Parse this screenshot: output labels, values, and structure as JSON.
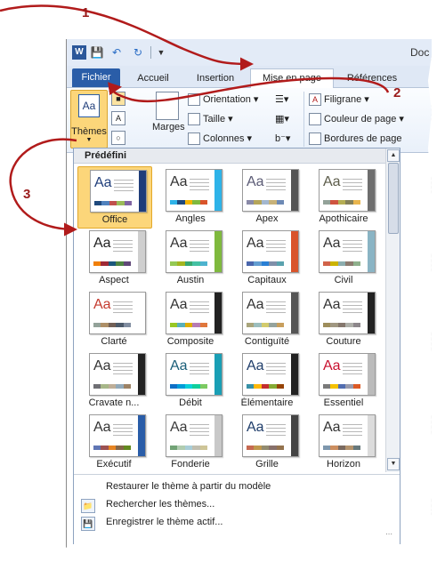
{
  "quick_access": {
    "app_icon": "W",
    "undo_icon": "undo-icon",
    "redo_icon": "redo-icon"
  },
  "window_title": "Doc",
  "tabs": [
    {
      "label": "Fichier"
    },
    {
      "label": "Accueil"
    },
    {
      "label": "Insertion"
    },
    {
      "label": "Mise en page"
    },
    {
      "label": "Références"
    }
  ],
  "ribbon": {
    "themes_label": "Thèmes",
    "themes_icon_text": "Aa",
    "marges_label": "Marges",
    "orientation_label": "Orientation",
    "taille_label": "Taille",
    "colonnes_label": "Colonnes",
    "filigrane_label": "Filigrane",
    "couleur_label": "Couleur de page",
    "bordures_label": "Bordures de page"
  },
  "gallery": {
    "section_title": "Prédéfini",
    "themes": [
      {
        "label": "Office",
        "aa": "Aa",
        "accent": "#1f3d7a",
        "aa_color": "#1f3d7a",
        "swatches": [
          "#1f497d",
          "#4f81bd",
          "#c0504d",
          "#9bbb59",
          "#8064a2"
        ]
      },
      {
        "label": "Angles",
        "aa": "Aa",
        "accent": "#2eb3e8",
        "aa_color": "#333333",
        "swatches": [
          "#2eb3e8",
          "#1f497d",
          "#f4b400",
          "#7fb93e",
          "#d9542b"
        ]
      },
      {
        "label": "Apex",
        "aa": "Aa",
        "accent": "#555555",
        "aa_color": "#5b5b75",
        "swatches": [
          "#8a8aa8",
          "#b5a55a",
          "#a3b7cf",
          "#c7b279",
          "#6d8ab5"
        ]
      },
      {
        "label": "Apothicaire",
        "aa": "Aa",
        "accent": "#6e6e6e",
        "aa_color": "#5c5c4a",
        "swatches": [
          "#93a299",
          "#cf543f",
          "#b5ae53",
          "#848058",
          "#e8b54d"
        ]
      },
      {
        "label": "Aspect",
        "aa": "Aa",
        "accent": "#cfcfcf",
        "aa_color": "#222222",
        "swatches": [
          "#f07f09",
          "#9f2936",
          "#1b587c",
          "#4e8542",
          "#604878"
        ]
      },
      {
        "label": "Austin",
        "aa": "Aa",
        "accent": "#7fb93e",
        "aa_color": "#333333",
        "swatches": [
          "#94c954",
          "#a3b61f",
          "#37a76f",
          "#44c1a3",
          "#4eb3cf"
        ]
      },
      {
        "label": "Capitaux",
        "aa": "Aa",
        "accent": "#d9542b",
        "aa_color": "#333333",
        "swatches": [
          "#4a66ac",
          "#629dd1",
          "#297fd5",
          "#7f8fa9",
          "#5aa2ae"
        ]
      },
      {
        "label": "Civil",
        "aa": "Aa",
        "accent": "#8ab4c4",
        "aa_color": "#333333",
        "swatches": [
          "#d16349",
          "#ccb400",
          "#8cadae",
          "#8c7b70",
          "#8fb08c"
        ]
      },
      {
        "label": "Clarté",
        "aa": "Aa",
        "accent": "#ffffff",
        "aa_color": "#c43a2e",
        "swatches": [
          "#93a299",
          "#ad8f67",
          "#726056",
          "#4c5a6a",
          "#808da0"
        ]
      },
      {
        "label": "Composite",
        "aa": "Aa",
        "accent": "#222222",
        "aa_color": "#333333",
        "swatches": [
          "#98c723",
          "#59b0b9",
          "#deae00",
          "#b77bb4",
          "#e0773c"
        ]
      },
      {
        "label": "Contiguïté",
        "aa": "Aa",
        "accent": "#555555",
        "aa_color": "#333333",
        "swatches": [
          "#a9a57c",
          "#9cbebd",
          "#d2cb6c",
          "#95a39d",
          "#c89f5d"
        ]
      },
      {
        "label": "Couture",
        "aa": "Aa",
        "accent": "#222222",
        "aa_color": "#333333",
        "swatches": [
          "#9e8e5c",
          "#a09781",
          "#85776d",
          "#aeafa9",
          "#8d878b"
        ]
      },
      {
        "label": "Cravate n...",
        "aa": "Aa",
        "accent": "#222222",
        "aa_color": "#333333",
        "swatches": [
          "#6f6f74",
          "#a7b789",
          "#beae98",
          "#92a9b9",
          "#9c8265"
        ]
      },
      {
        "label": "Débit",
        "aa": "Aa",
        "accent": "#1a9fb5",
        "aa_color": "#1a5e78",
        "swatches": [
          "#0f6fc6",
          "#009dd9",
          "#0bd0d9",
          "#10cf9b",
          "#7cca62"
        ]
      },
      {
        "label": "Élémentaire",
        "aa": "Aa",
        "accent": "#222222",
        "aa_color": "#1f3d6a",
        "swatches": [
          "#3891a7",
          "#feb80a",
          "#c32d2e",
          "#84aa33",
          "#964305"
        ]
      },
      {
        "label": "Essentiel",
        "aa": "Aa",
        "accent": "#bbbbbb",
        "aa_color": "#c8102e",
        "swatches": [
          "#7a7a7a",
          "#f5c201",
          "#526db0",
          "#989aac",
          "#dc5924"
        ]
      },
      {
        "label": "Exécutif",
        "aa": "Aa",
        "accent": "#2a5da8",
        "aa_color": "#333333",
        "swatches": [
          "#6076b4",
          "#9c5252",
          "#e68422",
          "#846648",
          "#63891f"
        ]
      },
      {
        "label": "Fonderie",
        "aa": "Aa",
        "accent": "#c8c8c8",
        "aa_color": "#3a3a3a",
        "swatches": [
          "#72a376",
          "#b0ccb0",
          "#a8cdd7",
          "#c0beaf",
          "#cec597"
        ]
      },
      {
        "label": "Grille",
        "aa": "Aa",
        "accent": "#444444",
        "aa_color": "#1f3d6a",
        "swatches": [
          "#c66951",
          "#bf974d",
          "#928b70",
          "#87706b",
          "#94734e"
        ]
      },
      {
        "label": "Horizon",
        "aa": "Aa",
        "accent": "#dcdcdc",
        "aa_color": "#333333",
        "swatches": [
          "#7e97ad",
          "#cc8e60",
          "#7a6a60",
          "#b4936d",
          "#67787b"
        ]
      }
    ],
    "menu": [
      {
        "label": "Restaurer le thème à partir du modèle"
      },
      {
        "label": "Rechercher les thèmes..."
      },
      {
        "label": "Enregistrer le thème actif..."
      }
    ]
  },
  "annotations": {
    "step1": "1",
    "step2": "2",
    "step3": "3",
    "arrow_color": "#b11b1b"
  }
}
